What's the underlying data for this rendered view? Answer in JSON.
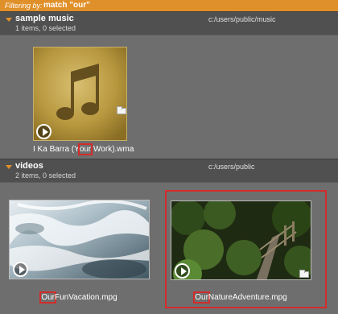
{
  "filter": {
    "label": "Filtering by:",
    "value": "match \"our\""
  },
  "groups": [
    {
      "name": "sample music",
      "count": "1 items, 0 selected",
      "path": "c:/users/public/music",
      "items": [
        {
          "name_pre": "I Ka Barra (Y",
          "name_match": "our",
          "name_post": " Work).wma",
          "icon": "music-note-icon"
        }
      ]
    },
    {
      "name": "videos",
      "count": "2 items, 0 selected",
      "path": "c:/users/public",
      "items": [
        {
          "name_pre": "",
          "name_match": "Our",
          "name_post": "FunVacation.mpg",
          "icon": "video-thumbnail"
        },
        {
          "name_pre": "",
          "name_match": "Our",
          "name_post": "NatureAdventure.mpg",
          "icon": "video-thumbnail"
        }
      ]
    }
  ],
  "colors": {
    "accent": "#e0902a",
    "highlight": "#d42b2b",
    "background": "#6e6e6e",
    "header": "#505050"
  }
}
